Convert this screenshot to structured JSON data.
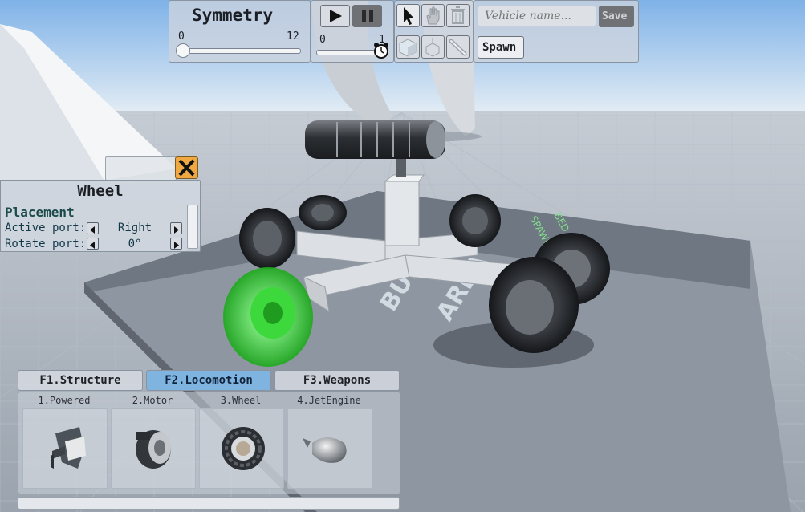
{
  "toolbar": {
    "symmetry_title": "Symmetry",
    "symmetry_min": "0",
    "symmetry_max": "12",
    "symmetry_value": 0,
    "time_min": "0",
    "time_max": "1",
    "time_value": 1,
    "vehicle_name_placeholder": "Vehicle name...",
    "save_label": "Save",
    "spawn_label": "Spawn"
  },
  "inspector": {
    "title": "Wheel",
    "section": "Placement",
    "active_port_label": "Active port:",
    "active_port_value": "Right",
    "rotate_port_label": "Rotate port:",
    "rotate_port_value": "0°"
  },
  "parts_panel": {
    "tabs": [
      {
        "label": "F1.Structure",
        "active": false
      },
      {
        "label": "F2.Locomotion",
        "active": true
      },
      {
        "label": "F3.Weapons",
        "active": false
      }
    ],
    "items": [
      {
        "label": "1.Powered",
        "icon": "powered-wheel-mount-icon"
      },
      {
        "label": "2.Motor",
        "icon": "motor-icon"
      },
      {
        "label": "3.Wheel",
        "icon": "wheel-icon"
      },
      {
        "label": "4.JetEngine",
        "icon": "jet-engine-icon"
      }
    ]
  },
  "scene": {
    "floor_text": "BUILD AREA",
    "spawn_marker_text": "SPAWN BED",
    "colors": {
      "sky_top": "#7fb2e8",
      "sky_horizon": "#e2ecf4",
      "ground": "#a9b3bf",
      "build_pad": "#8e96a1",
      "selected_part": "#2fd02f"
    }
  }
}
